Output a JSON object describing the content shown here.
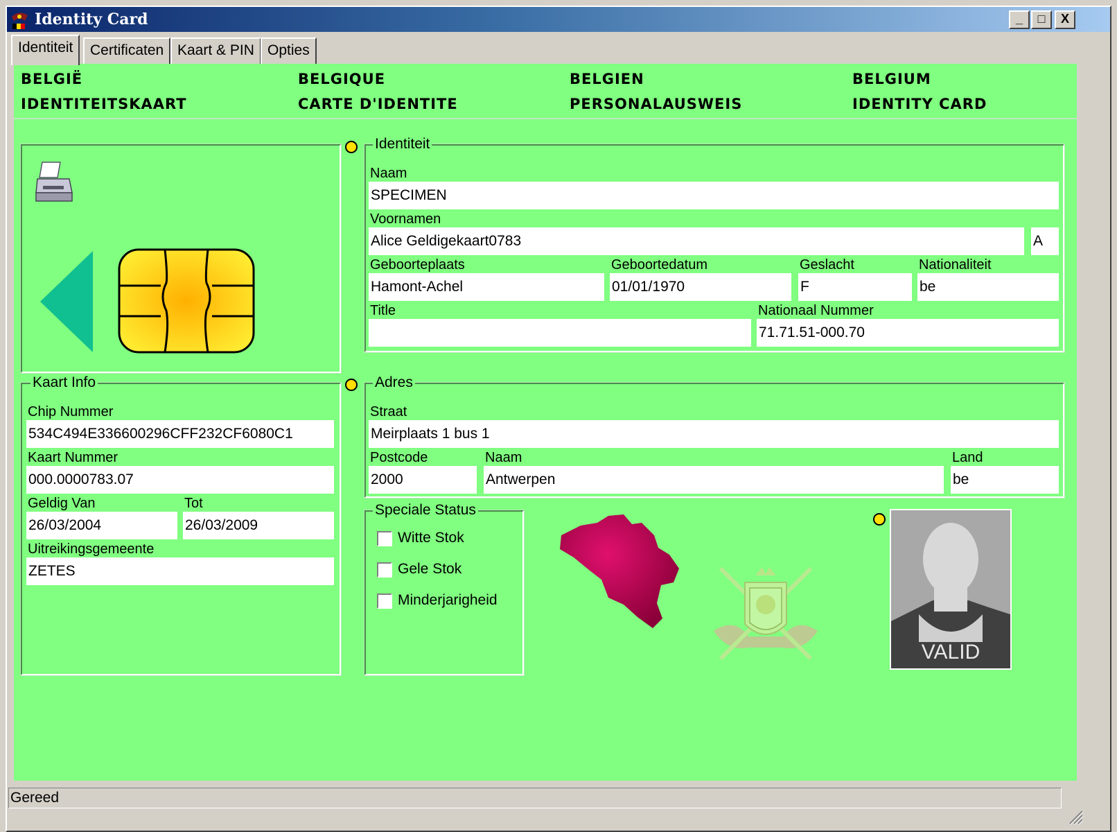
{
  "window": {
    "title": "Identity Card",
    "minimize_label": "_",
    "maximize_label": "□",
    "close_label": "X"
  },
  "tabs": [
    {
      "label": "Identiteit",
      "active": true
    },
    {
      "label": "Certificaten",
      "active": false
    },
    {
      "label": "Kaart & PIN",
      "active": false
    },
    {
      "label": "Opties",
      "active": false
    }
  ],
  "header": {
    "nl_country": "BELGIË",
    "nl_doc": "IDENTITEITSKAART",
    "fr_country": "BELGIQUE",
    "fr_doc": "CARTE D'IDENTITE",
    "de_country": "BELGIEN",
    "de_doc": "PERSONALAUSWEIS",
    "en_country": "BELGIUM",
    "en_doc": "IDENTITY CARD"
  },
  "kaart_info": {
    "legend": "Kaart Info",
    "chip_label": "Chip Nummer",
    "chip_value": "534C494E336600296CFF232CF6080C1",
    "kaart_label": "Kaart Nummer",
    "kaart_value": "000.0000783.07",
    "van_label": "Geldig Van",
    "van_value": "26/03/2004",
    "tot_label": "Tot",
    "tot_value": "26/03/2009",
    "gemeente_label": "Uitreikingsgemeente",
    "gemeente_value": "ZETES"
  },
  "identiteit": {
    "legend": "Identiteit",
    "naam_label": "Naam",
    "naam_value": "SPECIMEN",
    "voornamen_label": "Voornamen",
    "voornamen_value": "Alice Geldigekaart0783",
    "initiaal_value": "A",
    "geboorteplaats_label": "Geboorteplaats",
    "geboorteplaats_value": "Hamont-Achel",
    "geboortedatum_label": "Geboortedatum",
    "geboortedatum_value": "01/01/1970",
    "geslacht_label": "Geslacht",
    "geslacht_value": "F",
    "nationaliteit_label": "Nationaliteit",
    "nationaliteit_value": "be",
    "title_label": "Title",
    "title_value": "",
    "nationaal_label": "Nationaal Nummer",
    "nationaal_value": "71.71.51-000.70"
  },
  "adres": {
    "legend": "Adres",
    "straat_label": "Straat",
    "straat_value": "Meirplaats 1 bus 1",
    "postcode_label": "Postcode",
    "postcode_value": "2000",
    "naam_label": "Naam",
    "naam_value": "Antwerpen",
    "land_label": "Land",
    "land_value": "be"
  },
  "speciale_status": {
    "legend": "Speciale Status",
    "items": [
      {
        "label": "Witte Stok",
        "checked": false
      },
      {
        "label": "Gele Stok",
        "checked": false
      },
      {
        "label": "Minderjarigheid",
        "checked": false
      }
    ]
  },
  "photo": {
    "stamp": "VALID"
  },
  "status": {
    "text": "Gereed"
  },
  "colors": {
    "panel_green": "#80ff80",
    "map_magenta": "#b0004a",
    "chip_gold": "#ffd800",
    "arrow_teal": "#10c090"
  }
}
